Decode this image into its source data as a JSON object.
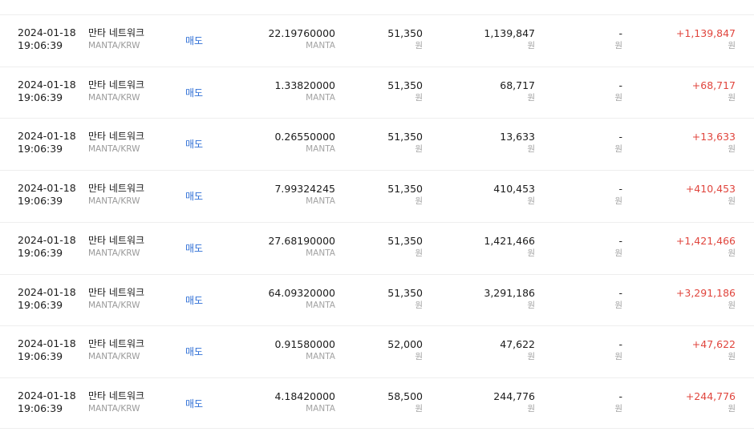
{
  "rows": [
    {
      "date": "2024-01-18",
      "time": "19:06:39",
      "market_name": "만타 네트워크",
      "market_pair": "MANTA/KRW",
      "side": "매도",
      "amount": "22.19760000",
      "amount_unit": "MANTA",
      "price": "51,350",
      "price_unit": "원",
      "total": "1,139,847",
      "total_unit": "원",
      "fee": "-",
      "fee_unit": "원",
      "settlement": "+1,139,847",
      "settlement_unit": "원"
    },
    {
      "date": "2024-01-18",
      "time": "19:06:39",
      "market_name": "만타 네트워크",
      "market_pair": "MANTA/KRW",
      "side": "매도",
      "amount": "1.33820000",
      "amount_unit": "MANTA",
      "price": "51,350",
      "price_unit": "원",
      "total": "68,717",
      "total_unit": "원",
      "fee": "-",
      "fee_unit": "원",
      "settlement": "+68,717",
      "settlement_unit": "원"
    },
    {
      "date": "2024-01-18",
      "time": "19:06:39",
      "market_name": "만타 네트워크",
      "market_pair": "MANTA/KRW",
      "side": "매도",
      "amount": "0.26550000",
      "amount_unit": "MANTA",
      "price": "51,350",
      "price_unit": "원",
      "total": "13,633",
      "total_unit": "원",
      "fee": "-",
      "fee_unit": "원",
      "settlement": "+13,633",
      "settlement_unit": "원"
    },
    {
      "date": "2024-01-18",
      "time": "19:06:39",
      "market_name": "만타 네트워크",
      "market_pair": "MANTA/KRW",
      "side": "매도",
      "amount": "7.99324245",
      "amount_unit": "MANTA",
      "price": "51,350",
      "price_unit": "원",
      "total": "410,453",
      "total_unit": "원",
      "fee": "-",
      "fee_unit": "원",
      "settlement": "+410,453",
      "settlement_unit": "원"
    },
    {
      "date": "2024-01-18",
      "time": "19:06:39",
      "market_name": "만타 네트워크",
      "market_pair": "MANTA/KRW",
      "side": "매도",
      "amount": "27.68190000",
      "amount_unit": "MANTA",
      "price": "51,350",
      "price_unit": "원",
      "total": "1,421,466",
      "total_unit": "원",
      "fee": "-",
      "fee_unit": "원",
      "settlement": "+1,421,466",
      "settlement_unit": "원"
    },
    {
      "date": "2024-01-18",
      "time": "19:06:39",
      "market_name": "만타 네트워크",
      "market_pair": "MANTA/KRW",
      "side": "매도",
      "amount": "64.09320000",
      "amount_unit": "MANTA",
      "price": "51,350",
      "price_unit": "원",
      "total": "3,291,186",
      "total_unit": "원",
      "fee": "-",
      "fee_unit": "원",
      "settlement": "+3,291,186",
      "settlement_unit": "원"
    },
    {
      "date": "2024-01-18",
      "time": "19:06:39",
      "market_name": "만타 네트워크",
      "market_pair": "MANTA/KRW",
      "side": "매도",
      "amount": "0.91580000",
      "amount_unit": "MANTA",
      "price": "52,000",
      "price_unit": "원",
      "total": "47,622",
      "total_unit": "원",
      "fee": "-",
      "fee_unit": "원",
      "settlement": "+47,622",
      "settlement_unit": "원"
    },
    {
      "date": "2024-01-18",
      "time": "19:06:39",
      "market_name": "만타 네트워크",
      "market_pair": "MANTA/KRW",
      "side": "매도",
      "amount": "4.18420000",
      "amount_unit": "MANTA",
      "price": "58,500",
      "price_unit": "원",
      "total": "244,776",
      "total_unit": "원",
      "fee": "-",
      "fee_unit": "원",
      "settlement": "+244,776",
      "settlement_unit": "원"
    }
  ],
  "colors": {
    "sell": "#2f6fd6",
    "positive": "#e0453d",
    "muted": "#9a9a9a",
    "divider": "#eeeeee"
  }
}
